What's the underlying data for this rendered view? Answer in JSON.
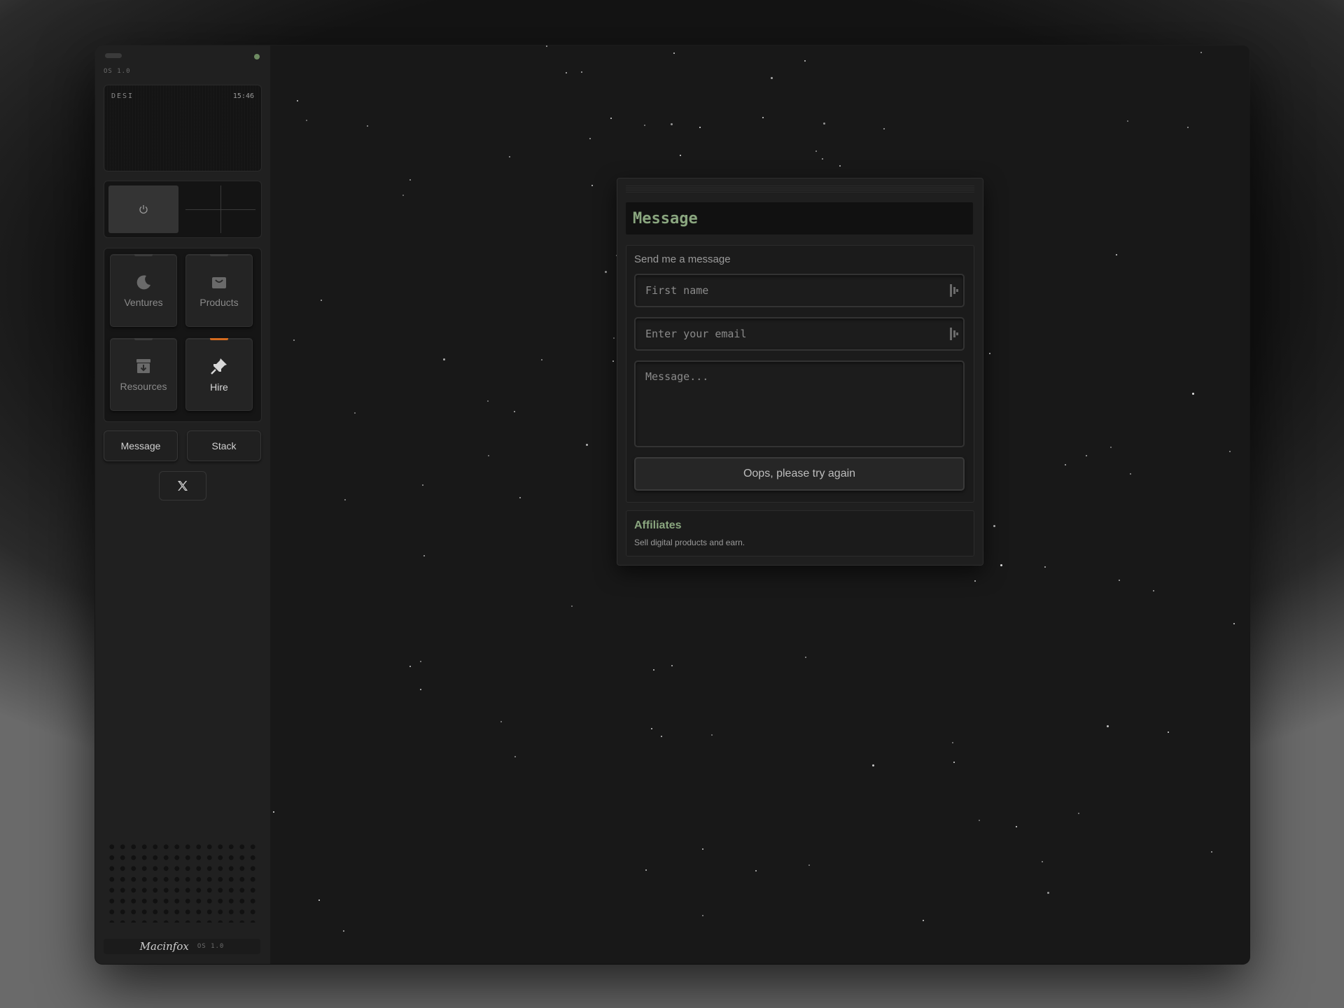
{
  "sidebar": {
    "os_label": "OS 1.0",
    "screen": {
      "left_label": "DESI",
      "time": "15:46"
    },
    "power_icon": "power-icon",
    "tiles": [
      {
        "label": "Ventures",
        "icon": "moon-icon"
      },
      {
        "label": "Products",
        "icon": "bag-icon"
      },
      {
        "label": "Resources",
        "icon": "archive-download-icon"
      },
      {
        "label": "Hire",
        "icon": "pin-icon",
        "active": true,
        "accent": "#d46b1f"
      }
    ],
    "buttons": {
      "message": "Message",
      "stack": "Stack"
    },
    "x_icon": "x-logo-icon",
    "footer": {
      "brand": "Macinfox",
      "version": "OS 1.0"
    }
  },
  "window": {
    "title": "Message",
    "form": {
      "heading": "Send me a message",
      "first_name_placeholder": "First name",
      "email_placeholder": "Enter your email",
      "message_placeholder": "Message...",
      "submit_label": "Oops, please try again"
    },
    "affiliates": {
      "title": "Affiliates",
      "subtitle": "Sell digital products and earn."
    }
  },
  "colors": {
    "accent_green": "#8aa67f",
    "accent_orange": "#d46b1f",
    "background": "#181818"
  }
}
